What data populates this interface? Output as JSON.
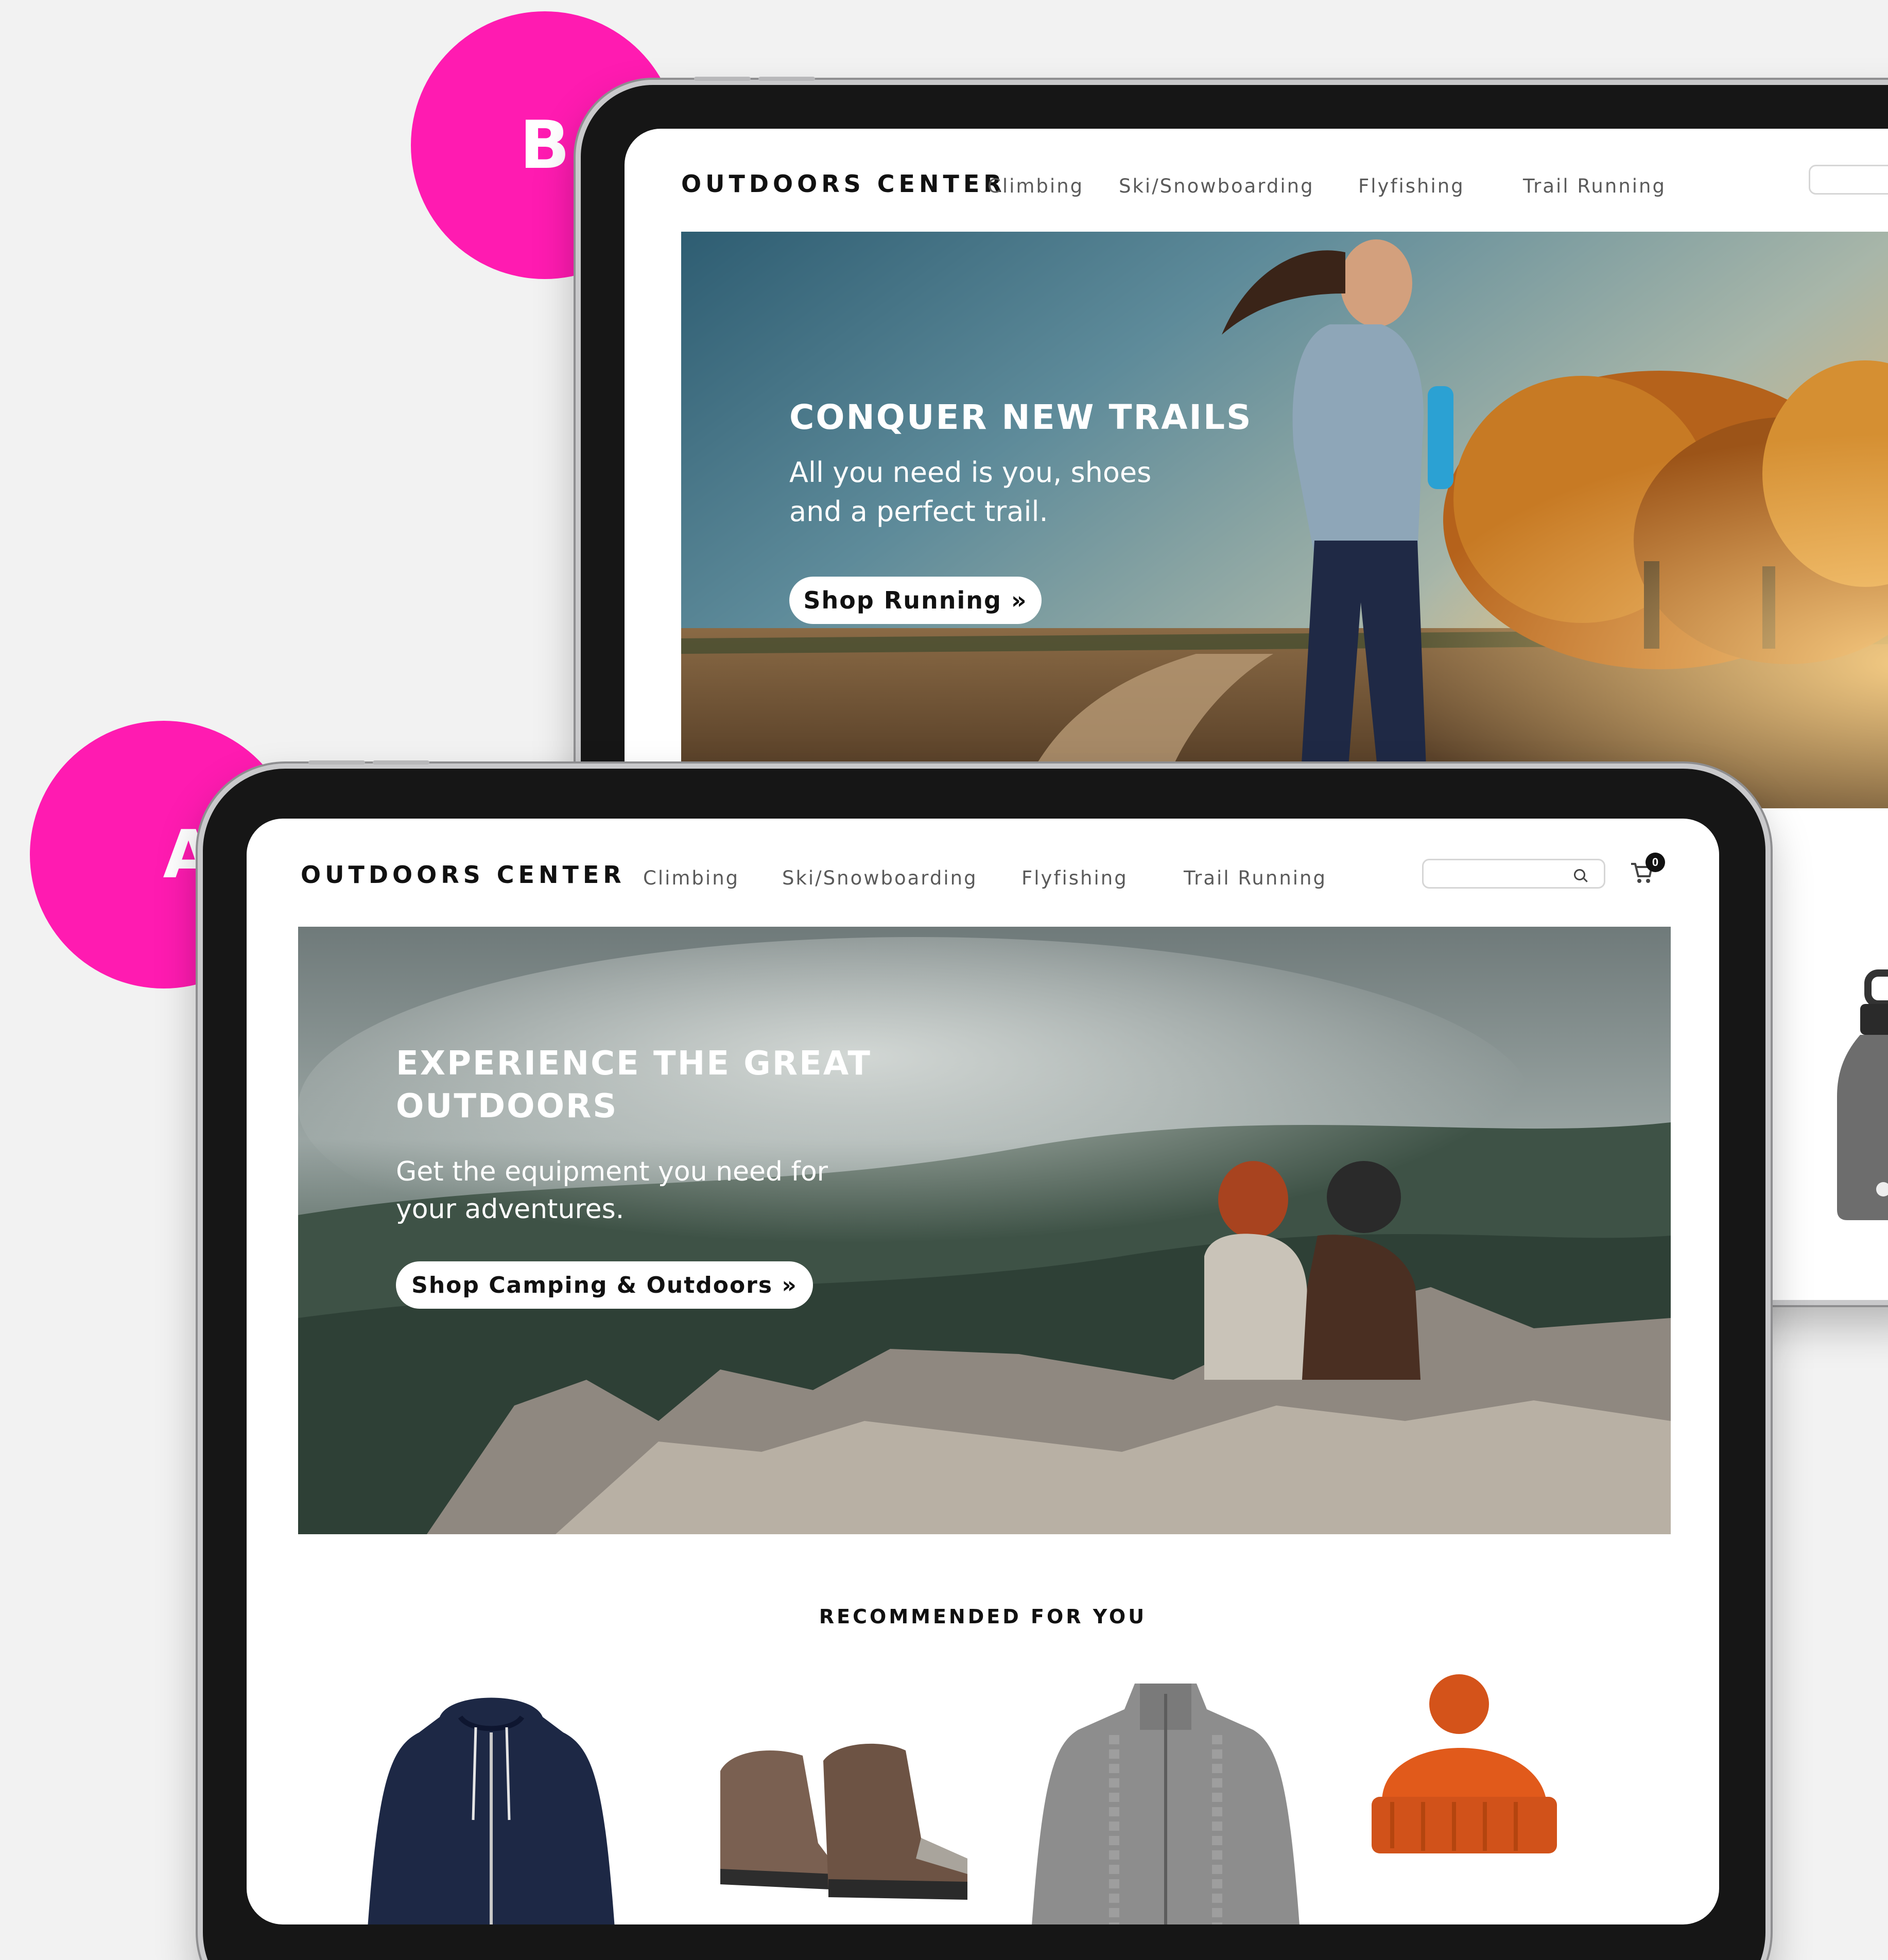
{
  "badges": {
    "variant_a": "A",
    "variant_b": "B",
    "color": "#ff1bb1"
  },
  "variant_b": {
    "logo": "OUTDOORS CENTER",
    "nav": [
      "Climbing",
      "Ski/Snowboarding",
      "Flyfishing",
      "Trail Running"
    ],
    "hero": {
      "title": "CONQUER NEW TRAILS",
      "subtitle_line1": "All you need is you, shoes",
      "subtitle_line2": "and a perfect trail.",
      "cta": "Shop Running »"
    },
    "side_product": "water-bottle"
  },
  "variant_a": {
    "logo": "OUTDOORS CENTER",
    "nav": [
      "Climbing",
      "Ski/Snowboarding",
      "Flyfishing",
      "Trail Running"
    ],
    "search": {
      "placeholder": ""
    },
    "cart": {
      "count": "0"
    },
    "hero": {
      "title_line1": "EXPERIENCE THE GREAT",
      "title_line2": "OUTDOORS",
      "subtitle_line1": "Get the equipment you need for",
      "subtitle_line2": "your adventures.",
      "cta": "Shop Camping & Outdoors »"
    },
    "recommended": {
      "title": "RECOMMENDED FOR YOU",
      "products": [
        "navy-rain-jacket",
        "hiking-boots",
        "grey-knit-cardigan",
        "orange-beanie"
      ]
    }
  },
  "colors": {
    "background": "#f2f2f2",
    "bezel": "#161616",
    "badge": "#ff1bb1",
    "cta_bg": "#ffffff"
  }
}
